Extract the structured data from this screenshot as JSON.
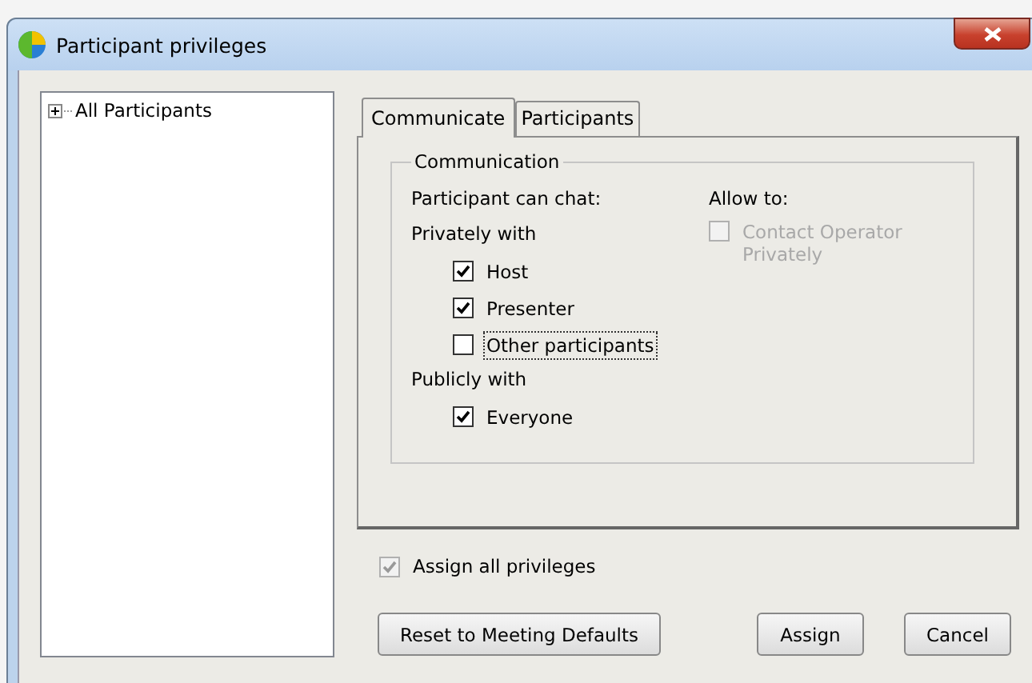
{
  "window": {
    "title": "Participant privileges"
  },
  "tree": {
    "items": [
      {
        "label": "All Participants",
        "expanded": false
      }
    ]
  },
  "tabs": [
    {
      "label": "Communicate",
      "selected": true
    },
    {
      "label": "Participants",
      "selected": false
    }
  ],
  "group": {
    "title": "Communication",
    "chat_label": "Participant can chat:",
    "private_label": "Privately with",
    "private": [
      {
        "label": "Host",
        "checked": true,
        "focused": false
      },
      {
        "label": "Presenter",
        "checked": true,
        "focused": false
      },
      {
        "label": "Other participants",
        "checked": false,
        "focused": true
      }
    ],
    "public_label": "Publicly with",
    "public": [
      {
        "label": "Everyone",
        "checked": true,
        "focused": false
      }
    ],
    "allow_label": "Allow to:",
    "allow": [
      {
        "label": "Contact Operator Privately",
        "checked": false,
        "disabled": true
      }
    ]
  },
  "assign_all": {
    "label": "Assign all privileges",
    "checked": true,
    "disabled": true
  },
  "buttons": [
    {
      "label": "Reset to Meeting Defaults",
      "kind": "left"
    },
    {
      "label": "Assign",
      "kind": "right"
    },
    {
      "label": "Cancel",
      "kind": "right"
    }
  ]
}
